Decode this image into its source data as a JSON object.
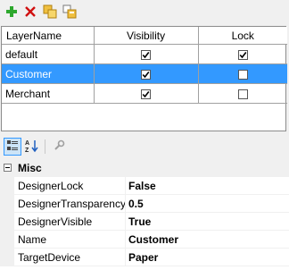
{
  "toolbar": {
    "icons": [
      "add-icon",
      "delete-icon",
      "copy-icon",
      "paste-icon"
    ],
    "colors": {
      "add": "#2ea82e",
      "delete": "#d01010",
      "folder": "#f0c040"
    }
  },
  "grid": {
    "columns": [
      "LayerName",
      "Visibility",
      "Lock"
    ],
    "rows": [
      {
        "name": "default",
        "visibility": true,
        "lock": true,
        "selected": false
      },
      {
        "name": "Customer",
        "visibility": true,
        "lock": false,
        "selected": true
      },
      {
        "name": "Merchant",
        "visibility": true,
        "lock": false,
        "selected": false
      }
    ],
    "selection_color": "#3399ff"
  },
  "property_grid": {
    "toolbar_icons": [
      "categorized-icon",
      "alphabetical-sort-icon",
      "property-pages-icon"
    ],
    "category": "Misc",
    "properties": [
      {
        "name": "DesignerLock",
        "value": "False"
      },
      {
        "name": "DesignerTransparency",
        "value": "0.5"
      },
      {
        "name": "DesignerVisible",
        "value": "True"
      },
      {
        "name": "Name",
        "value": "Customer"
      },
      {
        "name": "TargetDevice",
        "value": "Paper"
      }
    ]
  }
}
